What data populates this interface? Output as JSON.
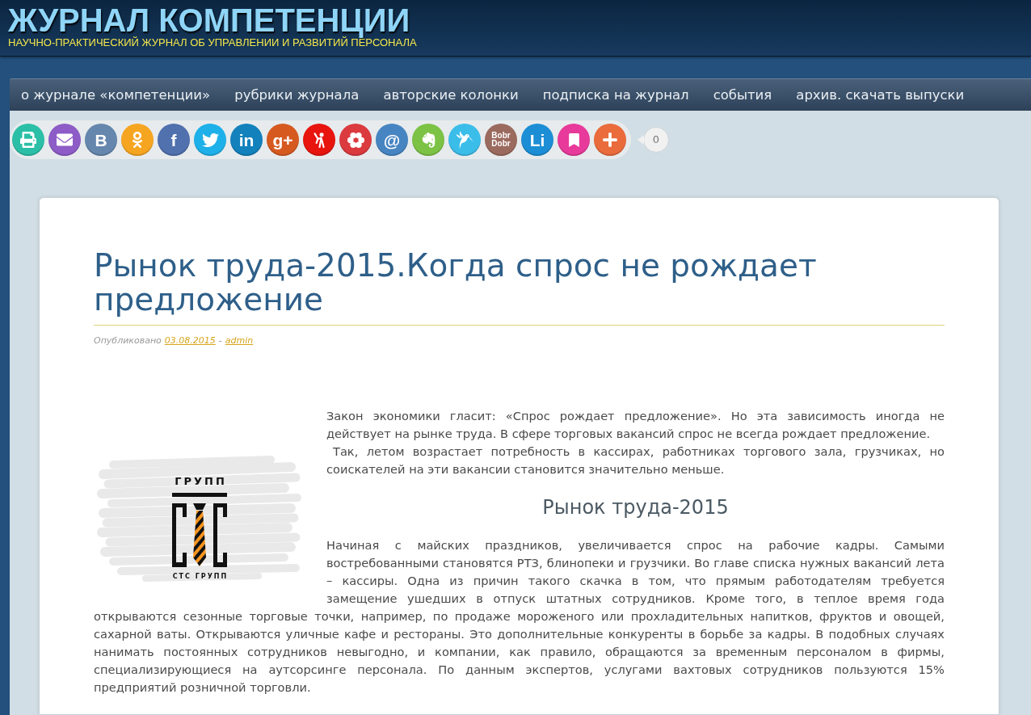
{
  "header": {
    "title": "ЖУРНАЛ КОМПЕТЕНЦИИ",
    "subtitle": "НАУЧНО-ПРАКТИЧЕСКИЙ ЖУРНАЛ ОБ УПРАВЛЕНИИ И РАЗВИТИЙ ПЕРСОНАЛА"
  },
  "nav": [
    "о журнале «компетенции»",
    "рубрики журнала",
    "авторские колонки",
    "подписка на журнал",
    "события",
    "архив. скачать выпуски"
  ],
  "share": {
    "buttons": [
      {
        "kind": "printer",
        "color": "#2cbfa7"
      },
      {
        "kind": "envelope",
        "color": "#8d5cc7"
      },
      {
        "kind": "letters",
        "glyph": "B",
        "color": "#6587ad"
      },
      {
        "kind": "person",
        "color": "#f6a521"
      },
      {
        "kind": "letters",
        "glyph": "f",
        "color": "#5070ae"
      },
      {
        "kind": "bird",
        "color": "#1eb0e9"
      },
      {
        "kind": "letters",
        "glyph": "in",
        "color": "#1281bc"
      },
      {
        "kind": "letters",
        "glyph": "g+",
        "color": "#d65a20"
      },
      {
        "kind": "figure",
        "color": "#e8140e"
      },
      {
        "kind": "flower",
        "color": "#db3a3f"
      },
      {
        "kind": "letters",
        "glyph": "@",
        "color": "#4785c2"
      },
      {
        "kind": "elephant",
        "color": "#7cc245"
      },
      {
        "kind": "hummingbird",
        "color": "#3bbde9"
      },
      {
        "kind": "stacked",
        "glyph": "Bobr Dobr",
        "color": "#9b6a5e"
      },
      {
        "kind": "letters",
        "glyph": "Li",
        "color": "#1c8ed5"
      },
      {
        "kind": "bookmark",
        "color": "#e83a9b"
      },
      {
        "kind": "plus",
        "color": "#ea6b3c"
      }
    ],
    "count": "0"
  },
  "article": {
    "title": "Рынок труда-2015.Когда спрос не рождает предложение",
    "meta": {
      "prefix": "Опубликовано",
      "date": "03.08.2015",
      "separator": "-",
      "author": "admin"
    },
    "image": {
      "top_text": "ГРУПП",
      "caption": "СТС ГРУПП"
    },
    "intro": [
      "Закон экономики гласит: «Спрос рождает предложение». Но эта зависимость иногда не действует на рынке труда. В сфере торговых вакансий спрос не всегда рождает предложение.",
      "Так, летом возрастает потребность в кассирах, работниках торгового зала, грузчиках, но соискателей на эти вакансии становится значительно меньше."
    ],
    "subheading": "Рынок труда-2015",
    "paragraph": [
      "Начиная с майских праздников, увеличивается спрос на рабочие кадры. Самыми востребованными становятся РТЗ, блинопеки и грузчики. Во главе списка нужных вакансий лета – кассиры. Одна из причин такого скачка в том, что прямым работодателям требуется замещение ушедших в отпуск штатных сотрудников. Кроме того, в теплое время года",
      "открываются сезонные торговые точки, например, по продаже мороженого или прохладительных напитков, фруктов и овощей, сахарной ваты. Открываются уличные кафе и рестораны. Это дополнительные конкуренты в борьбе за кадры. В подобных случаях нанимать постоянных сотрудников невыгодно, и компании, как правило, обращаются за временным персоналом в фирмы, специализирующиеся на аутсорсинге персонала. По данным экспертов, услугами вахтовых сотрудников пользуются 15% предприятий розничной торговли."
    ]
  }
}
